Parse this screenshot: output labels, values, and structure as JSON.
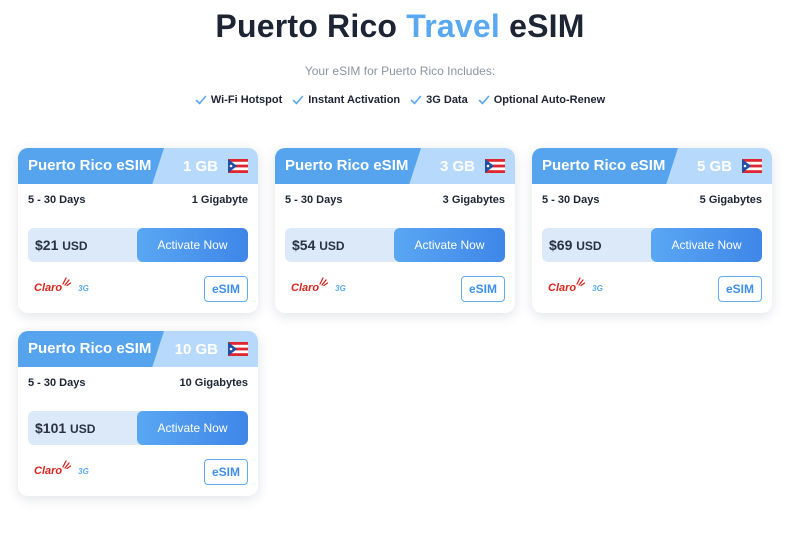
{
  "header": {
    "title_part1": "Puerto Rico ",
    "title_accent": "Travel",
    "title_part2": " eSIM",
    "subtitle": "Your eSIM for Puerto Rico Includes:",
    "accent_color": "#5aa8f0"
  },
  "features": [
    {
      "label": "Wi-Fi Hotspot",
      "icon": "check-icon"
    },
    {
      "label": "Instant Activation",
      "icon": "check-icon"
    },
    {
      "label": "3G Data",
      "icon": "check-icon"
    },
    {
      "label": "Optional Auto-Renew",
      "icon": "check-icon"
    }
  ],
  "plans": [
    {
      "name": "Puerto Rico eSIM",
      "gb": "1 GB",
      "days": "5 - 30 Days",
      "data": "1 Gigabyte",
      "price": "$21",
      "currency": "USD",
      "button": "Activate Now",
      "carrier": "Claro",
      "network": "3G",
      "badge": "eSIM"
    },
    {
      "name": "Puerto Rico eSIM",
      "gb": "3 GB",
      "days": "5 - 30 Days",
      "data": "3 Gigabytes",
      "price": "$54",
      "currency": "USD",
      "button": "Activate Now",
      "carrier": "Claro",
      "network": "3G",
      "badge": "eSIM"
    },
    {
      "name": "Puerto Rico eSIM",
      "gb": "5 GB",
      "days": "5 - 30 Days",
      "data": "5 Gigabytes",
      "price": "$69",
      "currency": "USD",
      "button": "Activate Now",
      "carrier": "Claro",
      "network": "3G",
      "badge": "eSIM"
    },
    {
      "name": "Puerto Rico eSIM",
      "gb": "10 GB",
      "days": "5 - 30 Days",
      "data": "10 Gigabytes",
      "price": "$101",
      "currency": "USD",
      "button": "Activate Now",
      "carrier": "Claro",
      "network": "3G",
      "badge": "eSIM"
    }
  ],
  "colors": {
    "header_blue": "#56a4ee",
    "header_light": "#b7d9fb",
    "price_bg": "#dbe9f8",
    "carrier_red": "#d8261f"
  }
}
